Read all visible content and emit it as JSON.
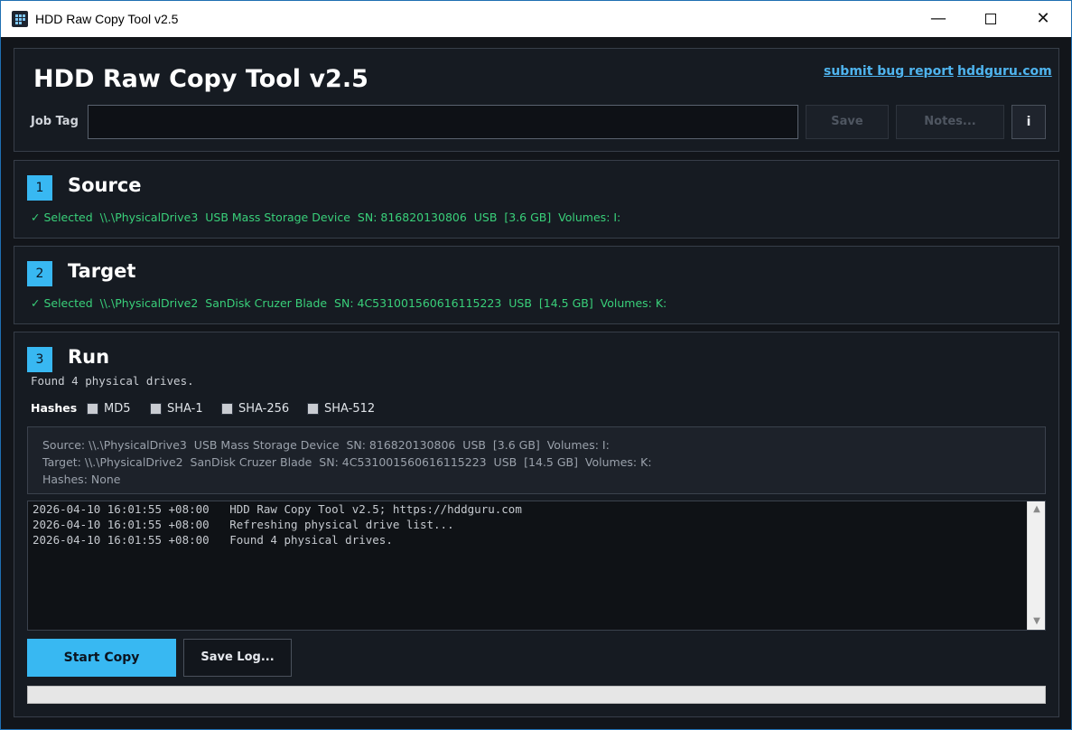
{
  "window": {
    "title": "HDD Raw Copy Tool v2.5",
    "controls": {
      "minimize": "—",
      "maximize": "",
      "close": "✕"
    }
  },
  "header": {
    "app_title": "HDD Raw Copy Tool v2.5",
    "links": {
      "bug_report": "submit bug report",
      "site": "hddguru.com"
    },
    "job_tag_label": "Job Tag",
    "job_tag_value": "",
    "save_label": "Save",
    "notes_label": "Notes...",
    "info_label": "i"
  },
  "source": {
    "step": "1",
    "title": "Source",
    "selected": "✓ Selected  \\\\.\\PhysicalDrive3  USB Mass Storage Device  SN: 816820130806  USB  [3.6 GB]  Volumes: I:"
  },
  "target": {
    "step": "2",
    "title": "Target",
    "selected": "✓ Selected  \\\\.\\PhysicalDrive2  SanDisk Cruzer Blade  SN: 4C531001560616115223  USB  [14.5 GB]  Volumes: K:"
  },
  "run": {
    "step": "3",
    "title": "Run",
    "status": "Found 4 physical drives.",
    "hashes_label": "Hashes",
    "hash_options": [
      {
        "label": "MD5",
        "checked": false
      },
      {
        "label": "SHA-1",
        "checked": false
      },
      {
        "label": "SHA-256",
        "checked": false
      },
      {
        "label": "SHA-512",
        "checked": false
      }
    ],
    "summary": {
      "source": "Source: \\\\.\\PhysicalDrive3  USB Mass Storage Device  SN: 816820130806  USB  [3.6 GB]  Volumes: I:",
      "target": "Target: \\\\.\\PhysicalDrive2  SanDisk Cruzer Blade  SN: 4C531001560616115223  USB  [14.5 GB]  Volumes: K:",
      "hashes": "Hashes: None"
    },
    "log": [
      "2026-04-10 16:01:55 +08:00   HDD Raw Copy Tool v2.5; https://hddguru.com",
      "2026-04-10 16:01:55 +08:00   Refreshing physical drive list...",
      "2026-04-10 16:01:55 +08:00   Found 4 physical drives."
    ],
    "start_label": "Start Copy",
    "save_log_label": "Save Log...",
    "progress_percent": 0
  },
  "colors": {
    "accent": "#38b8f2",
    "selected_text": "#39d07a",
    "link": "#4fb4ee",
    "background": "#12151a",
    "panel": "#161b22"
  }
}
